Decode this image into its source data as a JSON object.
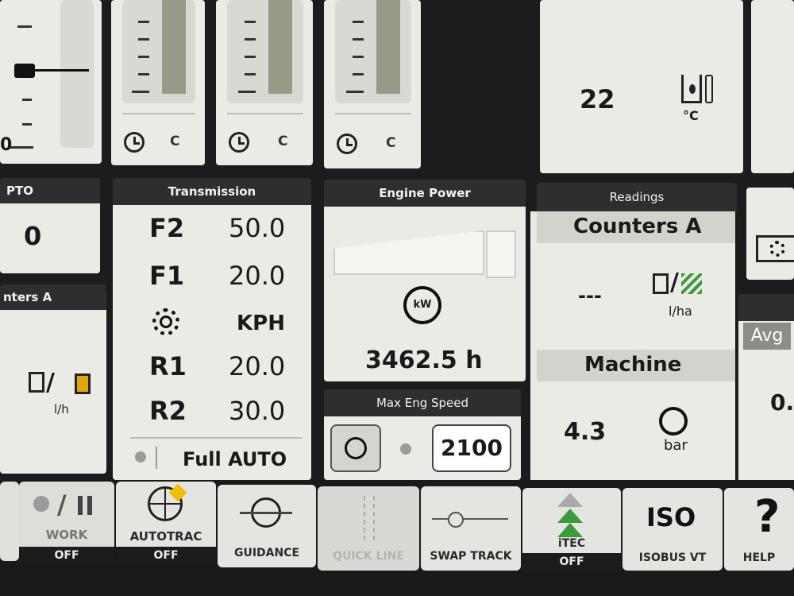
{
  "gauges": {
    "unit_label": "C"
  },
  "temp": {
    "value": "22",
    "unit": "°C"
  },
  "pto": {
    "header": "PTO",
    "value": "0"
  },
  "counters_left": {
    "header": "nters A",
    "unit": "l/h"
  },
  "transmission": {
    "header": "Transmission",
    "rows": [
      {
        "gear": "F2",
        "speed": "50.0"
      },
      {
        "gear": "F1",
        "speed": "20.0"
      },
      {
        "gear": "",
        "speed": "KPH"
      },
      {
        "gear": "R1",
        "speed": "20.0"
      },
      {
        "gear": "R2",
        "speed": "30.0"
      }
    ],
    "mode": "Full AUTO"
  },
  "engine_power": {
    "header": "Engine Power",
    "hours": "3462.5 h",
    "icon_label": "kW"
  },
  "max_eng_speed": {
    "header": "Max Eng Speed",
    "value": "2100"
  },
  "readings": {
    "header": "Readings",
    "counters_title": "Counters A",
    "counters_value": "---",
    "counters_unit": "l/ha",
    "machine_title": "Machine",
    "machine_value": "4.3",
    "machine_unit": "bar"
  },
  "right_col": {
    "avg_label": "Avg",
    "value": "0."
  },
  "toolbar": {
    "work": {
      "label": "WORK",
      "status": "OFF"
    },
    "autotrac": {
      "label": "AUTOTRAC",
      "status": "OFF"
    },
    "guidance": {
      "label": "GUIDANCE"
    },
    "quickline": {
      "label": "QUICK LINE"
    },
    "swaptrack": {
      "label": "SWAP TRACK"
    },
    "itec": {
      "label": "iTEC",
      "status": "OFF"
    },
    "isobus": {
      "label": "ISOBUS VT",
      "logo": "ISO"
    },
    "help": {
      "label": "HELP",
      "glyph": "?"
    }
  }
}
